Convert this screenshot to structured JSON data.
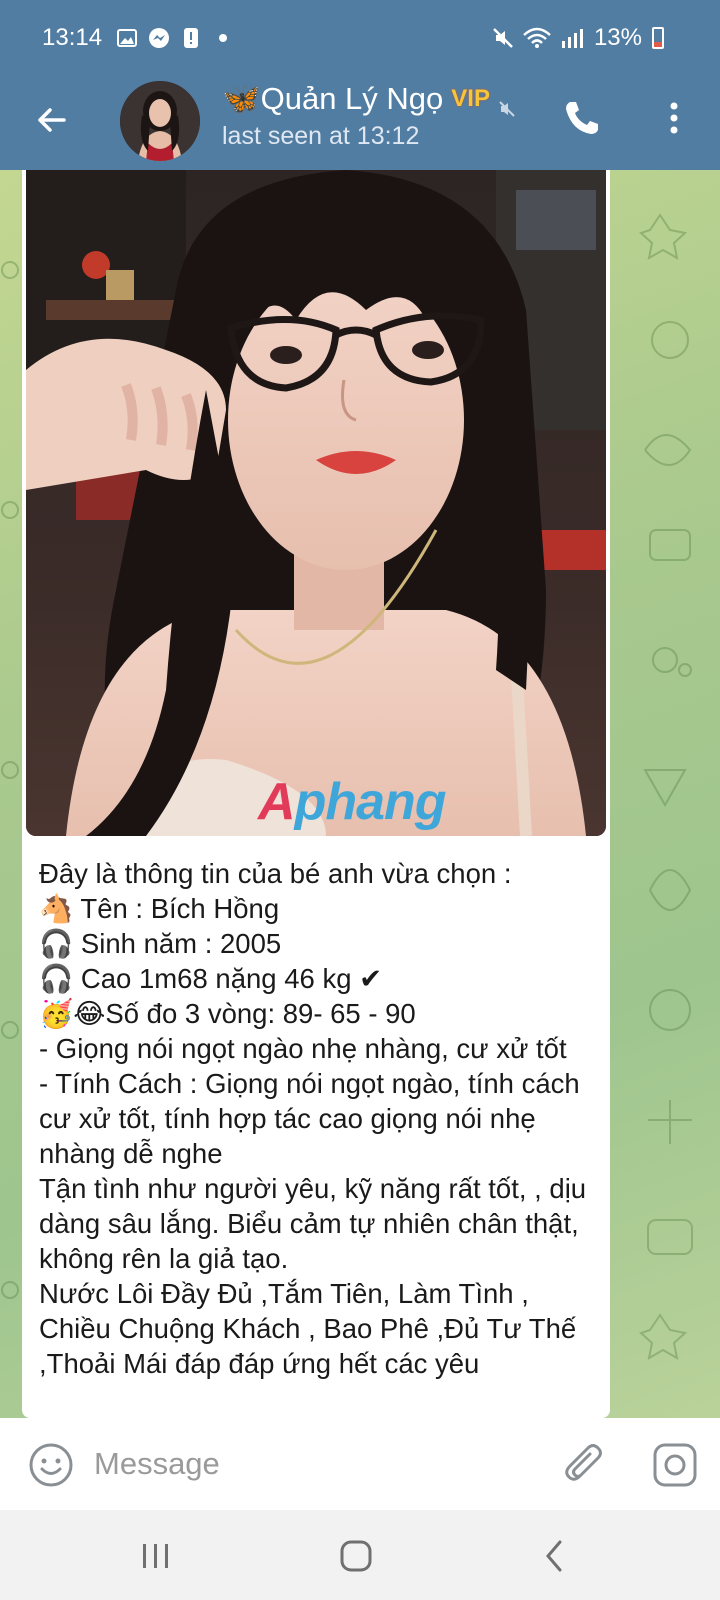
{
  "status_bar": {
    "time": "13:14",
    "battery": "13%",
    "left_icons": [
      "gallery-icon",
      "messenger-icon",
      "alert-icon",
      "dot-icon"
    ],
    "right_icons": [
      "mute-icon",
      "wifi-icon",
      "signal-icon",
      "battery-icon"
    ]
  },
  "header": {
    "title": "🦋Quản Lý Ngọ",
    "badge": "VIP",
    "subtitle": "last seen at 13:12",
    "icons": [
      "back-arrow-icon",
      "mute-icon",
      "phone-icon",
      "more-vertical-icon"
    ]
  },
  "message": {
    "watermark": {
      "part1": "A",
      "part2": "phang"
    },
    "lines": [
      {
        "emoji": "",
        "text": "Đây là thông tin của bé anh vừa chọn :"
      },
      {
        "emoji": "🐴",
        "text": " Tên : Bích Hồng"
      },
      {
        "emoji": "🎧",
        "text": " Sinh năm : 2005"
      },
      {
        "emoji": "🎧",
        "text": " Cao 1m68 nặng 46 kg ✔"
      },
      {
        "emoji": "🥳😂",
        "text": "Số đo 3 vòng: 89- 65 - 90"
      },
      {
        "emoji": "",
        "text": "- Giọng nói ngọt ngào nhẹ nhàng, cư xử tốt"
      },
      {
        "emoji": "",
        "text": "- Tính Cách : Giọng nói ngọt ngào, tính cách cư xử tốt, tính hợp tác cao giọng nói nhẹ nhàng dễ nghe"
      },
      {
        "emoji": "",
        "text": "Tận tình như người yêu, kỹ năng rất tốt, , dịu dàng sâu lắng. Biểu cảm tự nhiên chân thật, không rên la giả tạo."
      },
      {
        "emoji": "",
        "text": "Nước Lôi Đầy Đủ ,Tắm Tiên, Làm Tình , Chiều Chuộng Khách , Bao Phê ,Đủ Tư Thế ,Thoải Mái đáp đáp ứng hết các yêu"
      }
    ]
  },
  "composer": {
    "placeholder": "Message",
    "icons": [
      "emoji-icon",
      "attachment-icon",
      "camera-icon"
    ]
  },
  "navbar": {
    "icons": [
      "recent-apps-icon",
      "home-icon",
      "back-icon"
    ]
  },
  "colors": {
    "header": "#527da3",
    "chat_background": "#a9c98e",
    "bubble": "#ffffff",
    "vip": "#f7c43a"
  }
}
